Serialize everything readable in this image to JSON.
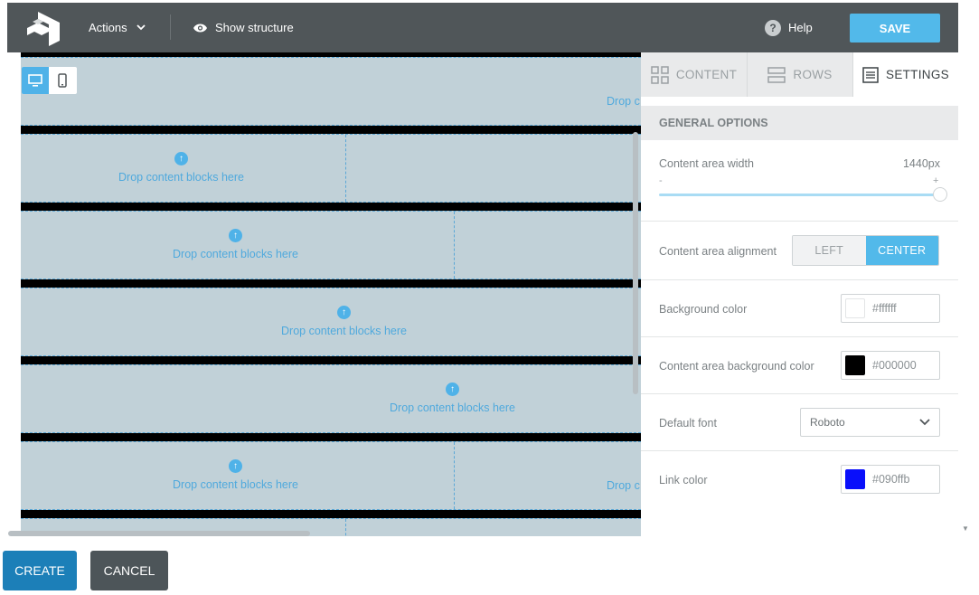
{
  "topbar": {
    "actions_label": "Actions",
    "show_structure_label": "Show structure",
    "help_label": "Help",
    "save_label": "SAVE"
  },
  "canvas": {
    "drop_label": "Drop content blocks here",
    "drop_label_truncated": "Drop c"
  },
  "panel": {
    "tabs": [
      {
        "label": "CONTENT"
      },
      {
        "label": "ROWS"
      },
      {
        "label": "SETTINGS"
      }
    ],
    "section_title": "GENERAL OPTIONS",
    "content_width": {
      "label": "Content area width",
      "value": "1440px",
      "min_label": "-",
      "max_label": "+",
      "slider_fraction": 1.0
    },
    "alignment": {
      "label": "Content area alignment",
      "options": [
        "LEFT",
        "CENTER"
      ],
      "selected": "CENTER"
    },
    "background_color": {
      "label": "Background color",
      "value": "#ffffff"
    },
    "content_bg_color": {
      "label": "Content area background color",
      "value": "#000000"
    },
    "default_font": {
      "label": "Default font",
      "value": "Roboto"
    },
    "link_color": {
      "label": "Link color",
      "value": "#090ffb"
    }
  },
  "footer": {
    "create_label": "CREATE",
    "cancel_label": "CANCEL"
  },
  "colors": {
    "accent": "#52b9ea",
    "topbar": "#505659",
    "create": "#1c7fb8",
    "cancel": "#4d5559"
  }
}
